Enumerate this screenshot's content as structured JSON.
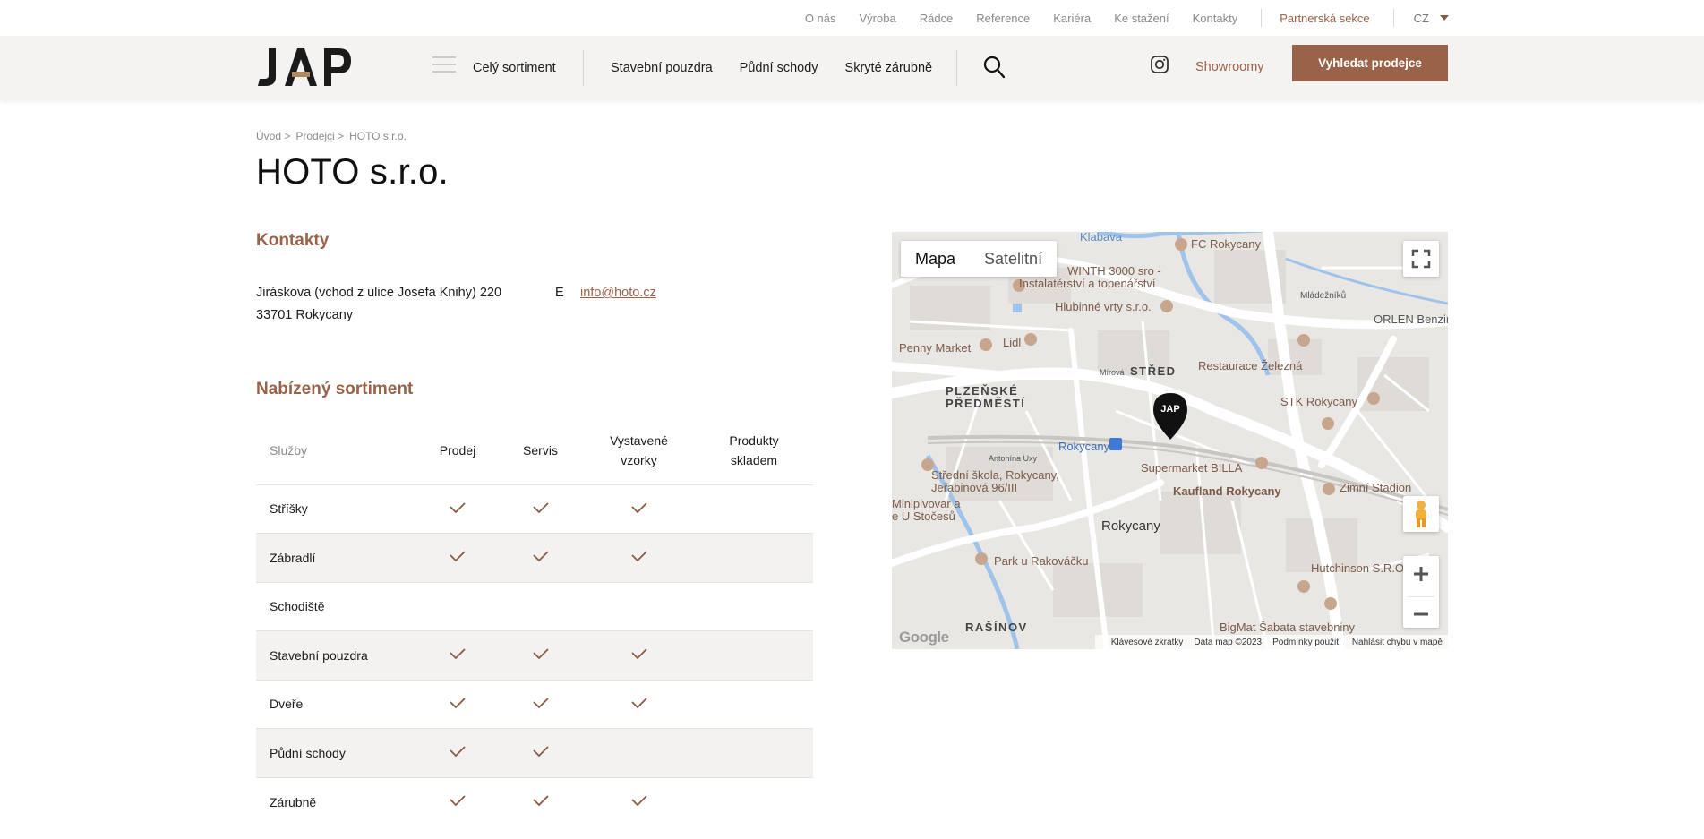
{
  "topbar": {
    "links": [
      "O nás",
      "Výroba",
      "Rádce",
      "Reference",
      "Kariéra",
      "Ke stažení",
      "Kontakty"
    ],
    "partner": "Partnerská sekce",
    "lang": "CZ"
  },
  "header": {
    "logo_text": "JAP",
    "all_products": "Celý sortiment",
    "nav": [
      "Stavební pouzdra",
      "Půdní schody",
      "Skryté zárubně"
    ],
    "showrooms": "Showroomy",
    "cta": "Vyhledat prodejce"
  },
  "breadcrumb": [
    "Úvod >",
    "Prodejci >",
    "HOTO s.r.o."
  ],
  "page_title": "HOTO s.r.o.",
  "contacts": {
    "title": "Kontakty",
    "address_line1": "Jiráskova (vchod z ulice Josefa Knihy) 220",
    "address_line2": "33701 Rokycany",
    "email_label": "E",
    "email": "info@hoto.cz"
  },
  "assortment": {
    "title": "Nabízený sortiment",
    "columns": [
      "Služby",
      "Prodej",
      "Servis",
      "Vystavené vzorky",
      "Produkty skladem"
    ],
    "rows": [
      {
        "name": "Stříšky",
        "checks": [
          true,
          true,
          true,
          false
        ]
      },
      {
        "name": "Zábradlí",
        "checks": [
          true,
          true,
          true,
          false
        ]
      },
      {
        "name": "Schodiště",
        "checks": [
          false,
          false,
          false,
          false
        ]
      },
      {
        "name": "Stavební pouzdra",
        "checks": [
          true,
          true,
          true,
          false
        ]
      },
      {
        "name": "Dveře",
        "checks": [
          true,
          true,
          true,
          false
        ]
      },
      {
        "name": "Půdní schody",
        "checks": [
          true,
          true,
          false,
          false
        ]
      },
      {
        "name": "Zárubně",
        "checks": [
          true,
          true,
          true,
          false
        ]
      }
    ]
  },
  "map": {
    "type_map": "Mapa",
    "type_satellite": "Satelitní",
    "marker_text": "JAP",
    "labels": {
      "fc": "FC Rokycany",
      "klabava": "Klabava",
      "winth1": "WINTH 3000 sro -",
      "winth2": "Instalatérství a topenářství",
      "hlubinne": "Hlubinné vrty s.r.o.",
      "mladezniku": "Mládežníků",
      "orlen": "ORLEN Benzina",
      "penny": "Penny Market",
      "lidl": "Lidl",
      "stred": "STŘED",
      "restaurace": "Restaurace Železná",
      "plzenske1": "PLZEŇSKÉ",
      "plzenske2": "PŘEDMĚSTÍ",
      "stk": "STK Rokycany",
      "rokycany_station": "Rokycany",
      "supermarket": "Supermarket BILLA",
      "stredni1": "Střední škola, Rokycany,",
      "stredni2": "Jeřabinová 96/III",
      "kaufland": "Kaufland Rokycany",
      "zimni": "Zimní Stadion",
      "minipivovar1": "Minipivovar a",
      "minipivovar2": "e U Stočesů",
      "rokycany": "Rokycany",
      "park": "Park u Rakováčku",
      "hutchinson": "Hutchinson S.R.O. Skla",
      "rasinov": "RAŠÍNOV",
      "bigmat": "BigMat Šabata stavebniny",
      "mirova": "Mírová",
      "antonina": "Antonína Uxy"
    },
    "footer": [
      "Klávesové zkratky",
      "Data map ©2023",
      "Podmínky použití",
      "Nahlásit chybu v mapě"
    ],
    "google": "Google"
  }
}
